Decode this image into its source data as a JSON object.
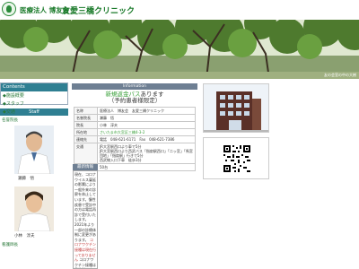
{
  "header": {
    "org": "医療法人 博友会",
    "clinic_name": "友愛三橋クリニック"
  },
  "banner": {
    "caption": "友の会室の中の大樹"
  },
  "sidebar": {
    "menu_title": "Contents",
    "items": [
      "◆施設概要",
      "◆スタッフ",
      "◆交通"
    ],
    "staff_title": "Staff",
    "staff": [
      {
        "role": "名誉院長",
        "name": "瀬藤　悟"
      },
      {
        "role": "院長",
        "name": "小林　淳夫"
      },
      {
        "role": "看護師長",
        "name": ""
      }
    ]
  },
  "information": {
    "heading": "Information",
    "notice_prefix": "新規",
    "notice_green": "新規返金パス",
    "notice_suffix": "あります",
    "notice_line2": "（予約患者様限定）",
    "rows": [
      {
        "key": "名称",
        "value": "医療法人　博友会　友愛三橋クリニック"
      },
      {
        "key": "名誉院長",
        "value": "瀬藤　悟"
      },
      {
        "key": "院長",
        "value": "小林　淳夫"
      },
      {
        "key": "所在地",
        "value": "さいたま市大宮区三橋4-3-2",
        "link": true
      },
      {
        "key": "連絡先",
        "value": "電話　048-621-6171　Fax　048-621-7386"
      },
      {
        "key": "交通",
        "value": "JR大宮駅西口より車で5分\nJR大宮駅西口より西武バス「指扇駅西口」「二ッ宮」「馬宮団地」「指扇駅」行きで5分\n西武線入口下車　徒歩3分"
      },
      {
        "key": "駐車場",
        "value": "50台"
      }
    ]
  },
  "news": {
    "heading": "最新情報",
    "body": "現在、コロナウイルス蔓延の影響により一般外来の診察を休止しています。慢性疾患で受診中の方は電話再診で受付いたします。",
    "body2": "2021年より一部の診療体制に変更があります。",
    "red": "コロナワクチン接種は現在行っておりません",
    "footer": "コロナワクチン接種は予約制です"
  },
  "colors": {
    "accent_green": "#1a7a2a",
    "header_bar": "#2f7f92",
    "info_bar": "#6e7f93"
  }
}
